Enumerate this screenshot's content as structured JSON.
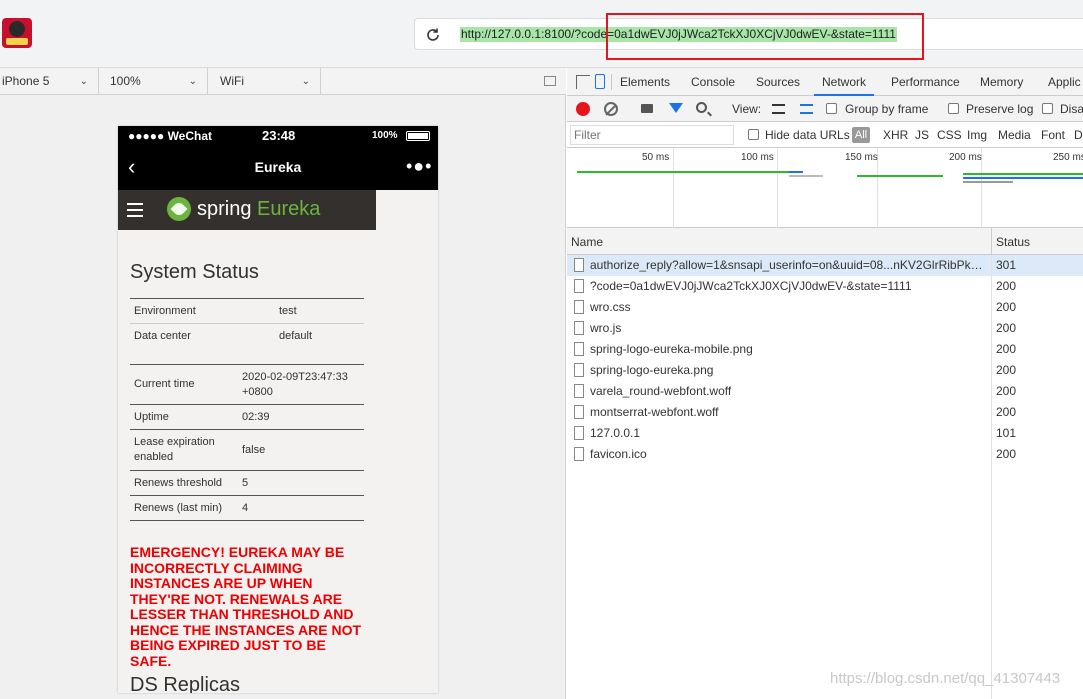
{
  "browser": {
    "url": "http://127.0.0.1:8100/?code=0a1dwEVJ0jJWca2TckXJ0XCjVJ0dwEV-&state=1111"
  },
  "device_toolbar": {
    "device": "iPhone 5",
    "zoom": "100%",
    "network": "WiFi"
  },
  "phone": {
    "carrier": "●●●●● WeChat",
    "time": "23:48",
    "battery_pct": "100%",
    "nav_title": "Eureka",
    "brand_spring": "spring",
    "brand_eureka": "Eureka",
    "section_title": "System Status",
    "env_rows": [
      {
        "label": "Environment",
        "value": "test"
      },
      {
        "label": "Data center",
        "value": "default"
      }
    ],
    "status_rows": [
      {
        "label": "Current time",
        "value": "2020-02-09T23:47:33 +0800"
      },
      {
        "label": "Uptime",
        "value": "02:39"
      },
      {
        "label": "Lease expiration enabled",
        "value": "false"
      },
      {
        "label": "Renews threshold",
        "value": "5"
      },
      {
        "label": "Renews (last min)",
        "value": "4"
      }
    ],
    "emergency": "EMERGENCY! EUREKA MAY BE INCORRECTLY CLAIMING INSTANCES ARE UP WHEN THEY'RE NOT. RENEWALS ARE LESSER THAN THRESHOLD AND HENCE THE INSTANCES ARE NOT BEING EXPIRED JUST TO BE SAFE.",
    "ds_title": "DS Replicas"
  },
  "devtools": {
    "tabs": [
      "Elements",
      "Console",
      "Sources",
      "Network",
      "Performance",
      "Memory",
      "Applic"
    ],
    "active_tab": "Network",
    "view_label": "View:",
    "group_by_frame": "Group by frame",
    "preserve_log": "Preserve log",
    "disable_cache": "Disa",
    "filter_placeholder": "Filter",
    "hide_data_urls": "Hide data URLs",
    "all_label": "All",
    "type_filters": [
      "XHR",
      "JS",
      "CSS",
      "Img",
      "Media",
      "Font",
      "D"
    ],
    "timeline_labels": [
      "50 ms",
      "100 ms",
      "150 ms",
      "200 ms",
      "250 ms"
    ],
    "columns": {
      "name": "Name",
      "status": "Status"
    },
    "requests": [
      {
        "name": "authorize_reply?allow=1&snsapi_userinfo=on&uuid=08...nKV2GlrRibPka...",
        "status": "301"
      },
      {
        "name": "?code=0a1dwEVJ0jJWca2TckXJ0XCjVJ0dwEV-&state=1111",
        "status": "200"
      },
      {
        "name": "wro.css",
        "status": "200"
      },
      {
        "name": "wro.js",
        "status": "200"
      },
      {
        "name": "spring-logo-eureka-mobile.png",
        "status": "200"
      },
      {
        "name": "spring-logo-eureka.png",
        "status": "200"
      },
      {
        "name": "varela_round-webfont.woff",
        "status": "200"
      },
      {
        "name": "montserrat-webfont.woff",
        "status": "200"
      },
      {
        "name": "127.0.0.1",
        "status": "101"
      },
      {
        "name": "favicon.ico",
        "status": "200"
      }
    ]
  },
  "watermark": "https://blog.csdn.net/qq_41307443",
  "colors": {
    "highlight_border": "#e8141c",
    "url_highlight": "#a8e6a8",
    "spring_green": "#6db33f",
    "emergency_red": "#ee0000",
    "devtools_accent": "#1a73e8"
  }
}
